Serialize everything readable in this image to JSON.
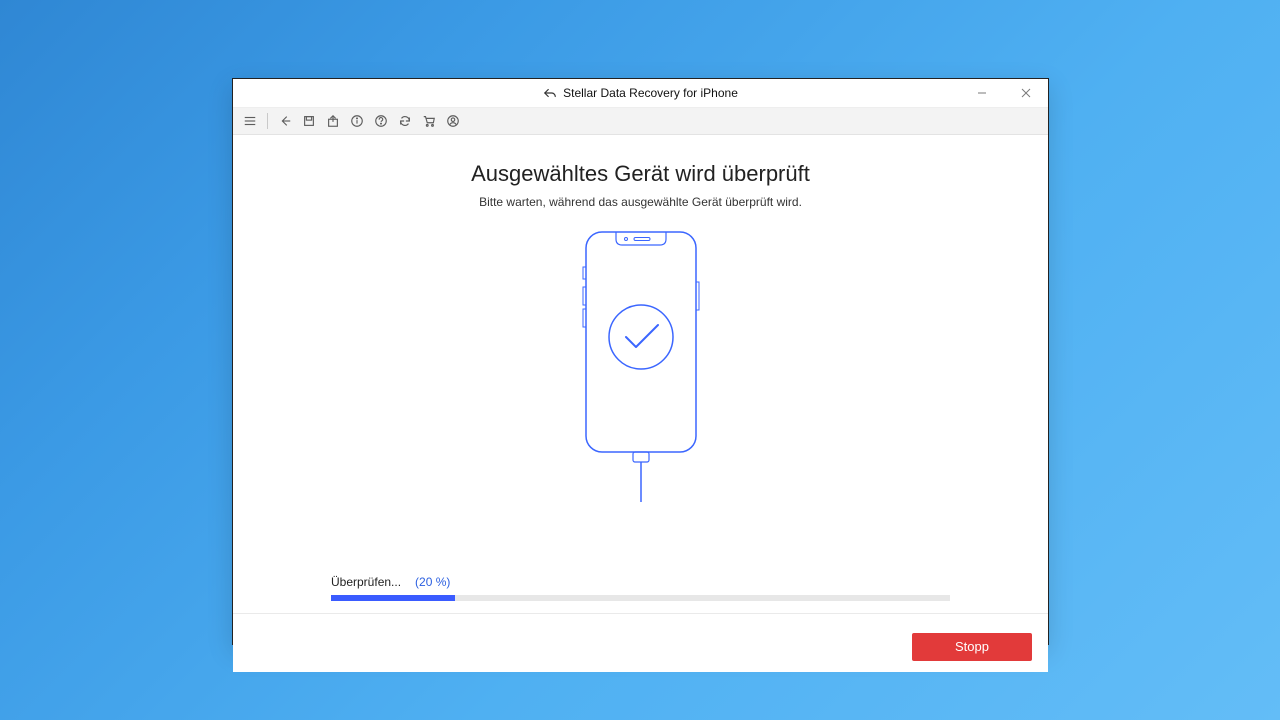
{
  "window": {
    "title": "Stellar Data Recovery for iPhone"
  },
  "main": {
    "headline": "Ausgewähltes Gerät wird überprüft",
    "subline": "Bitte warten, während das ausgewählte Gerät überprüft wird."
  },
  "progress": {
    "label": "Überprüfen...",
    "percent_text": "(20 %)",
    "percent_value": 20
  },
  "footer": {
    "stop_label": "Stopp"
  },
  "colors": {
    "accent_blue": "#3a5bff",
    "danger_red": "#e23a3a"
  }
}
